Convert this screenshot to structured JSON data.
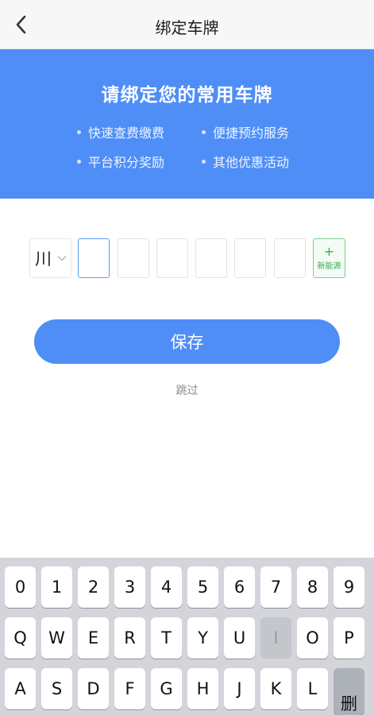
{
  "nav": {
    "title": "绑定车牌",
    "back_icon": "chevron-left-icon"
  },
  "banner": {
    "title": "请绑定您的常用车牌",
    "benefits": [
      "快速查费缴费",
      "便捷预约服务",
      "平台积分奖励",
      "其他优惠活动"
    ],
    "bg_color": "#4f8ef7"
  },
  "plate": {
    "province": "川",
    "chevron_icon": "chevron-down-icon",
    "chars": [
      "",
      "",
      "",
      "",
      "",
      ""
    ],
    "new_energy_plus": "+",
    "new_energy_label": "新能源",
    "new_energy_color": "#3aae4c"
  },
  "actions": {
    "save": "保存",
    "skip": "跳过"
  },
  "keyboard": {
    "row1": [
      "0",
      "1",
      "2",
      "3",
      "4",
      "5",
      "6",
      "7",
      "8",
      "9"
    ],
    "row2": [
      "Q",
      "W",
      "E",
      "R",
      "T",
      "Y",
      "U",
      "I",
      "O",
      "P"
    ],
    "row3": [
      "A",
      "S",
      "D",
      "F",
      "G",
      "H",
      "J",
      "K",
      "L"
    ],
    "delete_label": "删",
    "disabled_key": "I"
  }
}
